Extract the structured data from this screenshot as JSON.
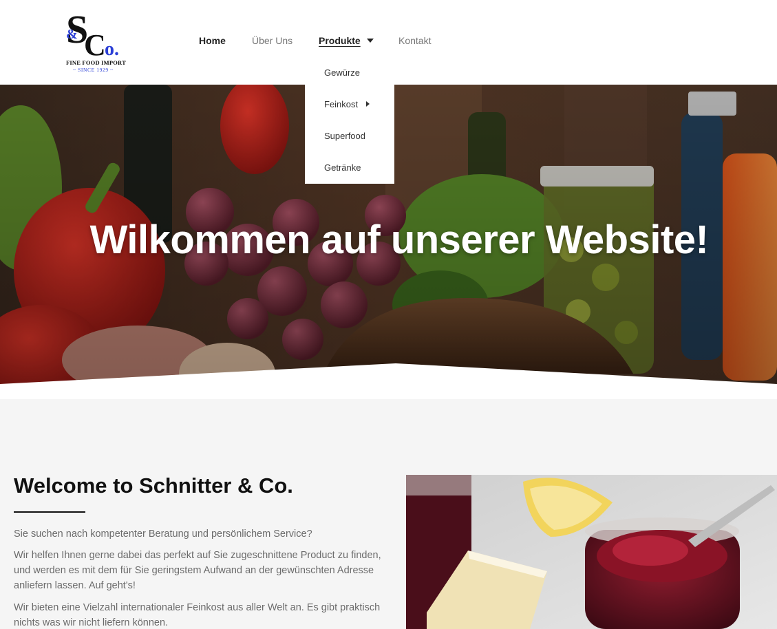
{
  "logo": {
    "mark_and": "&",
    "mark_letters": "SCo.",
    "tagline": "FINE FOOD IMPORT",
    "since": "~ SINCE 1929 ~"
  },
  "nav": {
    "items": [
      {
        "label": "Home"
      },
      {
        "label": "Über Uns"
      },
      {
        "label": "Produkte"
      },
      {
        "label": "Kontakt"
      }
    ]
  },
  "dropdown": {
    "items": [
      {
        "label": "Gewürze"
      },
      {
        "label": "Feinkost"
      },
      {
        "label": "Superfood"
      },
      {
        "label": "Getränke"
      }
    ]
  },
  "hero": {
    "title": "Wilkommen auf unserer Website!"
  },
  "about": {
    "title": "Welcome to Schnitter & Co.",
    "paragraphs": [
      "Sie suchen nach kompetenter Beratung und persönlichem Service?",
      "Wir helfen Ihnen gerne dabei das perfekt auf Sie zugeschnittene Product zu finden, und werden es mit dem für Sie geringstem Aufwand an der gewünschten Adresse anliefern lassen. Auf geht's!",
      "Wir bieten eine Vielzahl internationaler Feinkost aus aller Welt an. Es gibt praktisch nichts was wir nicht liefern können."
    ]
  },
  "colors": {
    "logo_blue": "#2b3fd6",
    "nav_active": "#222222",
    "nav_inactive": "#777777",
    "section_bg": "#f5f5f5"
  }
}
